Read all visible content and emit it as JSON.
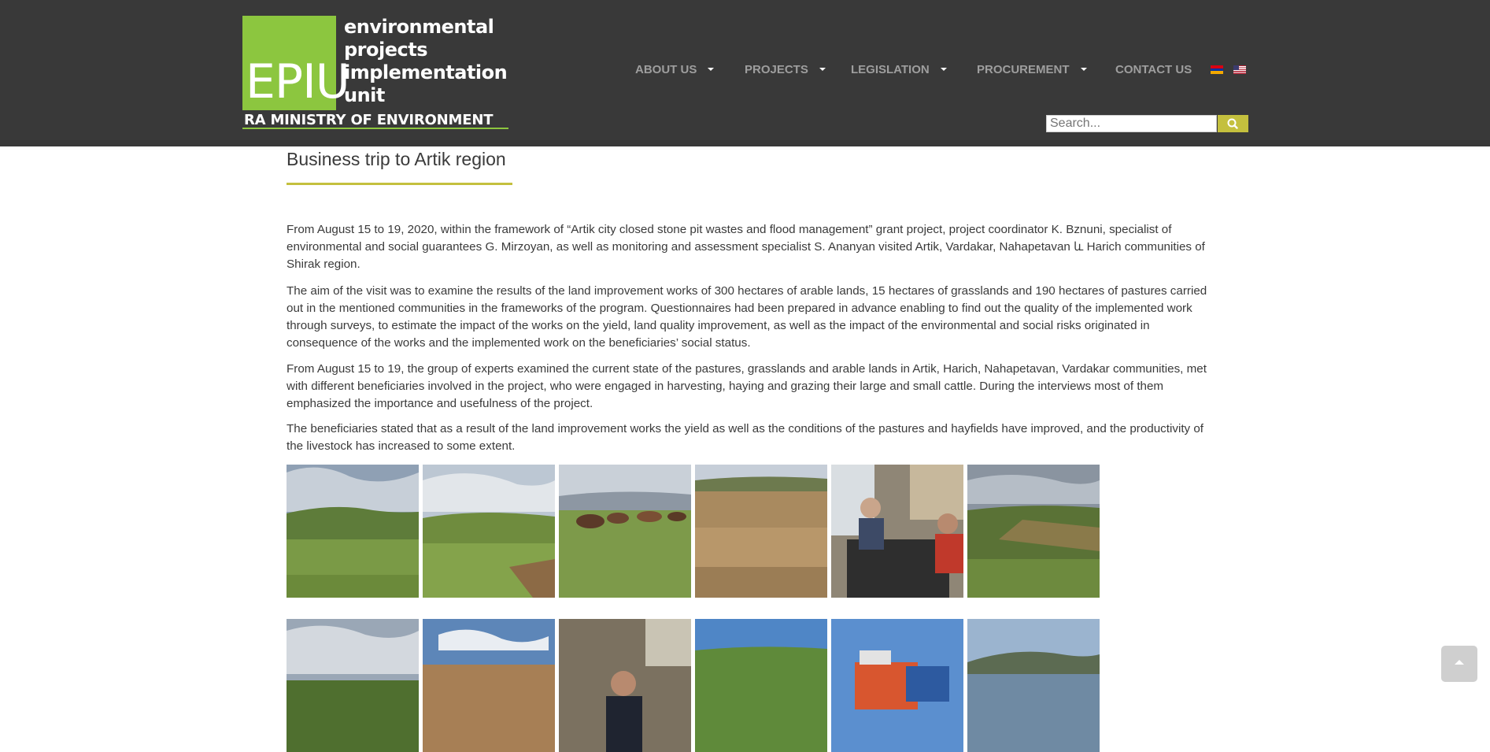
{
  "logo": {
    "mark": "EPIU",
    "lines": [
      "environmental",
      "projects",
      "implementation",
      "unit"
    ],
    "ministry": "RA MINISTRY OF ENVIRONMENT",
    "color": "#8cc63f"
  },
  "nav": {
    "items": [
      {
        "label": "ABOUT US",
        "dropdown": true
      },
      {
        "label": "PROJECTS",
        "dropdown": true
      },
      {
        "label": "LEGISLATION",
        "dropdown": true
      },
      {
        "label": "PROCUREMENT",
        "dropdown": true
      },
      {
        "label": "CONTACT US",
        "dropdown": false
      }
    ],
    "languages": [
      "armenian-flag-icon",
      "us-flag-icon"
    ]
  },
  "search": {
    "placeholder": "Search...",
    "button_icon": "search-icon"
  },
  "article": {
    "title": "Business trip to Artik region",
    "paragraphs": [
      "From August 15 to 19, 2020, within the framework of “Artik city closed stone pit wastes and flood management” grant project, project coordinator K. Bznuni, specialist of environmental and social guarantees G. Mirzoyan, as well as monitoring and assessment specialist S. Ananyan visited Artik, Vardakar, Nahapetavan և Harich communities of Shirak region.",
      "The aim of the visit was to examine the results of the land improvement works of 300 hectares of arable lands, 15 hectares of grasslands and 190 hectares of pastures carried out in the mentioned communities in the frameworks of the program. Questionnaires had been prepared in advance enabling to find out the quality of the implemented work through surveys, to estimate the impact of the works on the yield, land quality improvement, as well as the impact of the environmental and social risks originated in consequence of the works and the implemented work on the beneficiaries’ social status.",
      "From August 15 to 19, the group of experts examined the current state of the pastures, grasslands and arable lands in Artik, Harich, Nahapetavan, Vardakar communities, met with different beneficiaries involved in the project, who were engaged in harvesting, haying and grazing their large and small cattle. During the interviews most of them emphasized the importance and usefulness of the project.",
      "The beneficiaries stated that as a result of the land improvement works the yield as well as the conditions of the pastures and hayfields have improved, and the productivity of the livestock has increased to some extent."
    ]
  },
  "colors": {
    "header_bg": "#393939",
    "accent": "#c4c03e",
    "nav_text": "#9e9e9e"
  },
  "scroll_top_icon": "chevron-up-icon"
}
